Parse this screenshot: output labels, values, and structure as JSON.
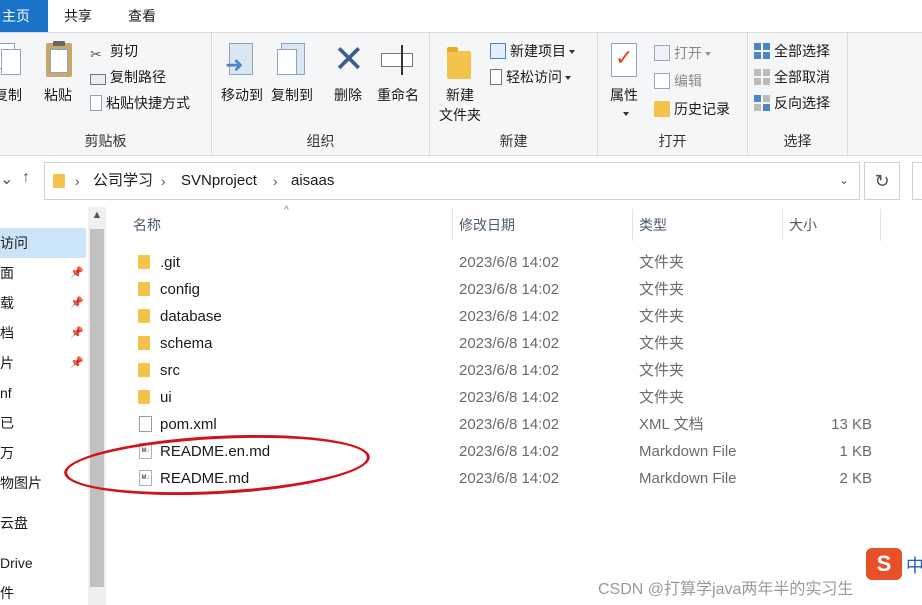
{
  "tabs": {
    "home": "主页",
    "share": "共享",
    "view": "查看"
  },
  "ribbon": {
    "clipboard": {
      "label": "剪贴板",
      "copy": "复制",
      "paste": "粘贴",
      "cut": "剪切",
      "copy_path": "复制路径",
      "paste_shortcut": "粘贴快捷方式"
    },
    "organize": {
      "label": "组织",
      "move_to": "移动到",
      "copy_to": "复制到",
      "delete": "删除",
      "rename": "重命名"
    },
    "new": {
      "label": "新建",
      "new_folder_line1": "新建",
      "new_folder_line2": "文件夹",
      "new_item": "新建项目",
      "easy_access": "轻松访问"
    },
    "open": {
      "label": "打开",
      "properties": "属性",
      "open": "打开",
      "edit": "编辑",
      "history": "历史记录"
    },
    "select": {
      "label": "选择",
      "select_all": "全部选择",
      "select_none": "全部取消",
      "invert": "反向选择"
    }
  },
  "address": {
    "crumbs": [
      "公司学习",
      "SVNproject",
      "aisaas"
    ]
  },
  "navpane": {
    "items": [
      "访问",
      "面",
      "载",
      "档",
      "片",
      "nf",
      "已",
      "万",
      "物图片",
      "云盘",
      "Drive",
      "件"
    ]
  },
  "columns": {
    "name": "名称",
    "date": "修改日期",
    "type": "类型",
    "size": "大小"
  },
  "files": [
    {
      "name": ".git",
      "date": "2023/6/8 14:02",
      "type": "文件夹",
      "size": ""
    },
    {
      "name": "config",
      "date": "2023/6/8 14:02",
      "type": "文件夹",
      "size": ""
    },
    {
      "name": "database",
      "date": "2023/6/8 14:02",
      "type": "文件夹",
      "size": ""
    },
    {
      "name": "schema",
      "date": "2023/6/8 14:02",
      "type": "文件夹",
      "size": ""
    },
    {
      "name": "src",
      "date": "2023/6/8 14:02",
      "type": "文件夹",
      "size": ""
    },
    {
      "name": "ui",
      "date": "2023/6/8 14:02",
      "type": "文件夹",
      "size": ""
    },
    {
      "name": "pom.xml",
      "date": "2023/6/8 14:02",
      "type": "XML 文档",
      "size": "13 KB"
    },
    {
      "name": "README.en.md",
      "date": "2023/6/8 14:02",
      "type": "Markdown File",
      "size": "1 KB"
    },
    {
      "name": "README.md",
      "date": "2023/6/8 14:02",
      "type": "Markdown File",
      "size": "2 KB"
    }
  ],
  "watermark": "CSDN @打算学java两年半的实习生",
  "ime_badge": "S",
  "ime_mode": "中",
  "colors": {
    "accent": "#1a73c8",
    "annotation": "#d1131b",
    "folder": "#f3c34b",
    "selected": "#cce4f7"
  }
}
